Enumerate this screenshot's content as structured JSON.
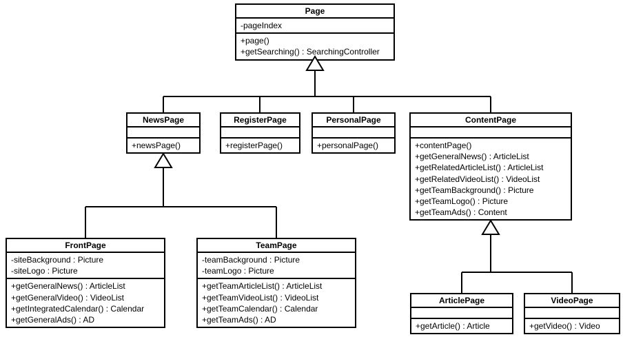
{
  "classes": {
    "Page": {
      "name": "Page",
      "attrs": [
        "-pageIndex"
      ],
      "ops": [
        "+page()",
        "+getSearching() : SearchingController"
      ]
    },
    "NewsPage": {
      "name": "NewsPage",
      "attrs": [],
      "ops": [
        "+newsPage()"
      ]
    },
    "RegisterPage": {
      "name": "RegisterPage",
      "attrs": [],
      "ops": [
        "+registerPage()"
      ]
    },
    "PersonalPage": {
      "name": "PersonalPage",
      "attrs": [],
      "ops": [
        "+personalPage()"
      ]
    },
    "ContentPage": {
      "name": "ContentPage",
      "attrs": [],
      "ops": [
        "+contentPage()",
        "+getGeneralNews() : ArticleList",
        "+getRelatedArticleList() : ArticleList",
        "+getRelatedVideoList() : VideoList",
        "+getTeamBackground() : Picture",
        "+getTeamLogo() : Picture",
        "+getTeamAds() : Content"
      ]
    },
    "FrontPage": {
      "name": "FrontPage",
      "attrs": [
        "-siteBackground : Picture",
        "-siteLogo : Picture"
      ],
      "ops": [
        "+getGeneralNews() : ArticleList",
        "+getGeneralVideo() : VideoList",
        "+getIntegratedCalendar() : Calendar",
        "+getGeneralAds() : AD"
      ]
    },
    "TeamPage": {
      "name": "TeamPage",
      "attrs": [
        "-teamBackground : Picture",
        "-teamLogo : Picture"
      ],
      "ops": [
        "+getTeamArticleList() : ArticleList",
        "+getTeamVideoList() : VideoList",
        "+getTeamCalendar() : Calendar",
        "+getTeamAds() : AD"
      ]
    },
    "ArticlePage": {
      "name": "ArticlePage",
      "attrs": [],
      "ops": [
        "+getArticle() : Article"
      ]
    },
    "VideoPage": {
      "name": "VideoPage",
      "attrs": [],
      "ops": [
        "+getVideo() : Video"
      ]
    }
  },
  "chart_data": {
    "type": "uml-class-diagram",
    "classes": [
      {
        "name": "Page",
        "attributes": [
          "-pageIndex"
        ],
        "operations": [
          "+page()",
          "+getSearching() : SearchingController"
        ]
      },
      {
        "name": "NewsPage",
        "attributes": [],
        "operations": [
          "+newsPage()"
        ]
      },
      {
        "name": "RegisterPage",
        "attributes": [],
        "operations": [
          "+registerPage()"
        ]
      },
      {
        "name": "PersonalPage",
        "attributes": [],
        "operations": [
          "+personalPage()"
        ]
      },
      {
        "name": "ContentPage",
        "attributes": [],
        "operations": [
          "+contentPage()",
          "+getGeneralNews() : ArticleList",
          "+getRelatedArticleList() : ArticleList",
          "+getRelatedVideoList() : VideoList",
          "+getTeamBackground() : Picture",
          "+getTeamLogo() : Picture",
          "+getTeamAds() : Content"
        ]
      },
      {
        "name": "FrontPage",
        "attributes": [
          "-siteBackground : Picture",
          "-siteLogo : Picture"
        ],
        "operations": [
          "+getGeneralNews() : ArticleList",
          "+getGeneralVideo() : VideoList",
          "+getIntegratedCalendar() : Calendar",
          "+getGeneralAds() : AD"
        ]
      },
      {
        "name": "TeamPage",
        "attributes": [
          "-teamBackground : Picture",
          "-teamLogo : Picture"
        ],
        "operations": [
          "+getTeamArticleList() : ArticleList",
          "+getTeamVideoList() : VideoList",
          "+getTeamCalendar() : Calendar",
          "+getTeamAds() : AD"
        ]
      },
      {
        "name": "ArticlePage",
        "attributes": [],
        "operations": [
          "+getArticle() : Article"
        ]
      },
      {
        "name": "VideoPage",
        "attributes": [],
        "operations": [
          "+getVideo() : Video"
        ]
      }
    ],
    "generalizations": [
      {
        "child": "NewsPage",
        "parent": "Page"
      },
      {
        "child": "RegisterPage",
        "parent": "Page"
      },
      {
        "child": "PersonalPage",
        "parent": "Page"
      },
      {
        "child": "ContentPage",
        "parent": "Page"
      },
      {
        "child": "FrontPage",
        "parent": "NewsPage"
      },
      {
        "child": "TeamPage",
        "parent": "NewsPage"
      },
      {
        "child": "ArticlePage",
        "parent": "ContentPage"
      },
      {
        "child": "VideoPage",
        "parent": "ContentPage"
      }
    ]
  }
}
